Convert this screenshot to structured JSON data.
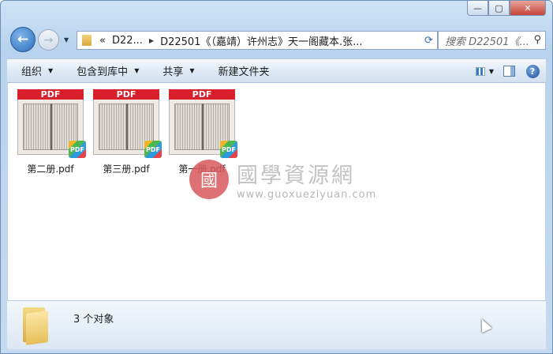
{
  "window": {
    "controls": {
      "minimize": "—",
      "maximize": "▢",
      "close": "✕"
    }
  },
  "nav": {
    "back_icon": "arrow-left-icon",
    "forward_icon": "arrow-right-icon"
  },
  "address": {
    "overflow": "«",
    "crumbs": [
      "D22...",
      "D22501《（嘉靖）许州志》天一阁藏本.张..."
    ]
  },
  "search": {
    "placeholder": "搜索 D22501《..."
  },
  "toolbar": {
    "organize": "组织",
    "include_library": "包含到库中",
    "share": "共享",
    "new_folder": "新建文件夹"
  },
  "files": [
    {
      "name": "第二册.pdf",
      "header": "PDF",
      "badge": "PDF"
    },
    {
      "name": "第三册.pdf",
      "header": "PDF",
      "badge": "PDF"
    },
    {
      "name": "第一册.pdf",
      "header": "PDF",
      "badge": "PDF"
    }
  ],
  "watermark": {
    "seal": "國",
    "title": "國學資源網",
    "url": "www.guoxueziyuan.com"
  },
  "status": {
    "count": "3 个对象"
  }
}
